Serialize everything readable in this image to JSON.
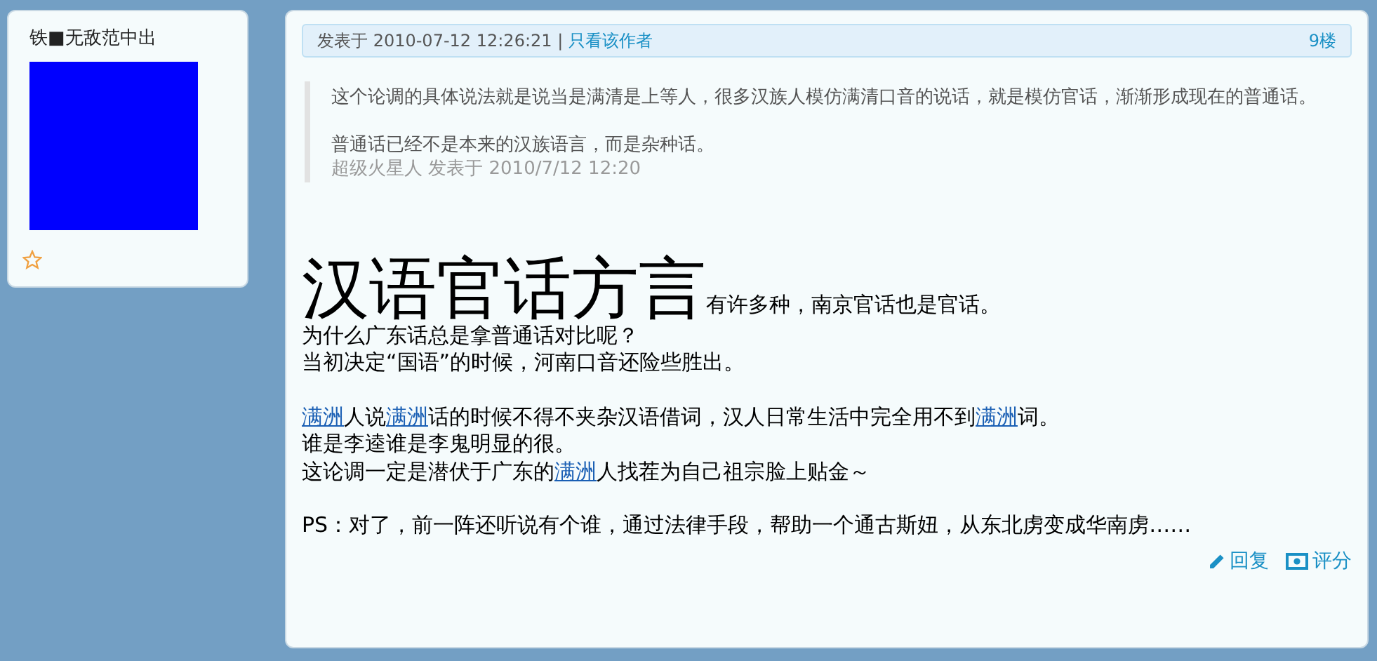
{
  "author": {
    "name": "铁■无敌范中出"
  },
  "post": {
    "header": {
      "posted": "发表于 2010-07-12 12:26:21",
      "separator": "|",
      "author_only": "只看该作者",
      "floor": "9楼"
    },
    "quote": {
      "paragraphs": [
        "这个论调的具体说法就是说当是满清是上等人，很多汉族人模仿满清口音的说话，就是模仿官话，渐渐形成现在的普通话。",
        "普通话已经不是本来的汉族语言，而是杂种话。"
      ],
      "attribution": "超级火星人 发表于 2010/7/12 12:20"
    },
    "title": "汉语官话方言",
    "paragraphs": [
      [
        [
          {
            "kind": "text",
            "text": "有许多种，南京官话也是官话。"
          }
        ],
        [
          {
            "kind": "text",
            "text": "为什么广东话总是拿普通话对比呢？"
          }
        ],
        [
          {
            "kind": "text",
            "text": "当初决定“国语”的时候，河南口音还险些胜出。"
          }
        ]
      ],
      [
        [
          {
            "kind": "keyword",
            "text": "满洲"
          },
          {
            "kind": "text",
            "text": "人说"
          },
          {
            "kind": "keyword",
            "text": "满洲"
          },
          {
            "kind": "text",
            "text": "话的时候不得不夹杂汉语借词，汉人日常生活中完全用不到"
          },
          {
            "kind": "keyword",
            "text": "满洲"
          },
          {
            "kind": "text",
            "text": "词。"
          }
        ],
        [
          {
            "kind": "text",
            "text": "谁是李逵谁是李鬼明显的很。"
          }
        ],
        [
          {
            "kind": "text",
            "text": "这论调一定是潜伏于广东的"
          },
          {
            "kind": "keyword",
            "text": "满洲"
          },
          {
            "kind": "text",
            "text": "人找茬为自己祖宗脸上贴金～"
          }
        ]
      ],
      [
        [
          {
            "kind": "text",
            "text": "PS：对了，前一阵还听说有个谁，通过法律手段，帮助一个通古斯妞，从东北虏变成华南虏……"
          }
        ]
      ]
    ],
    "actions": [
      {
        "kind": "reply",
        "label": "回复"
      },
      {
        "kind": "rate",
        "label": "评分"
      }
    ]
  }
}
